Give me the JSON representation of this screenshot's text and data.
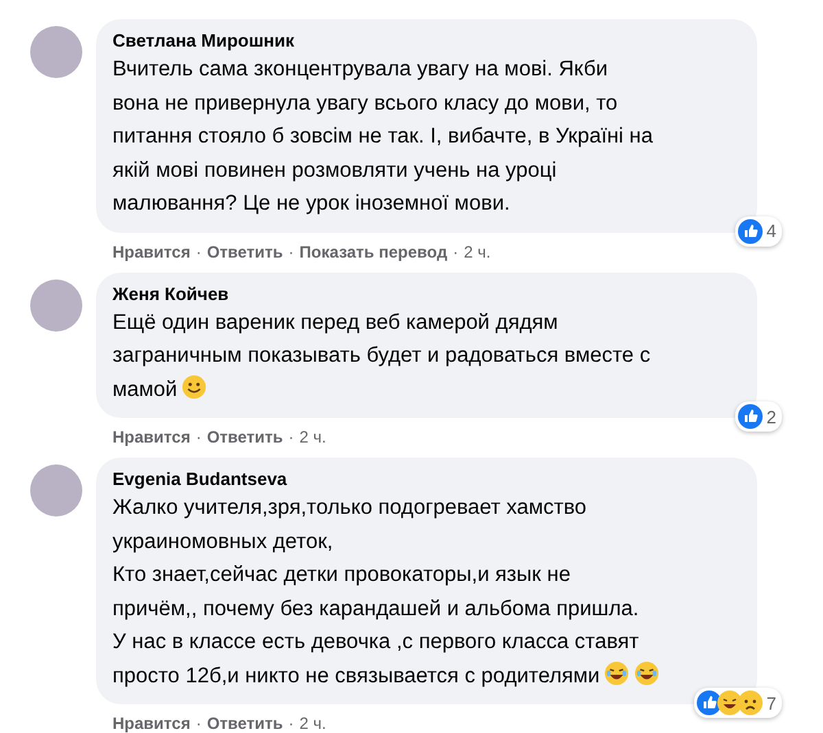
{
  "separator": "·",
  "comments": [
    {
      "author": "Светлана Мирошник",
      "text": "Вчитель сама зконцентрувала увагу на мові. Якби\nвона не привернула увагу всього класу до мови, то\nпитання стояло б зовсім не так. І, вибачте, в Україні на\nякій мові повинен розмовляти учень на уроці\nмалювання? Це не урок іноземної мови.",
      "reactions": [
        {
          "kind": "like"
        }
      ],
      "reaction_count": "4",
      "actions": [
        "Нравится",
        "Ответить",
        "Показать перевод"
      ],
      "time": "2 ч."
    },
    {
      "author": "Женя Койчев",
      "text": "Ещё один вареник перед веб камерой дядям\nзаграничным показывать будет и радоваться вместе с\nмамой",
      "emoji": [
        {
          "kind": "smile"
        }
      ],
      "reactions": [
        {
          "kind": "like"
        }
      ],
      "reaction_count": "2",
      "actions": [
        "Нравится",
        "Ответить"
      ],
      "time": "2 ч."
    },
    {
      "author": "Evgenia Budantseva",
      "text": "Жалко учителя,зря,только подогревает хамство\nукраиномовных деток,\nКто знает,сейчас детки провокаторы,и язык не\nпричём,, почему без карандашей и альбома пришла.\nУ нас в классе есть девочка ,с первого класса ставят\nпросто 12б,и никто не связывается с родителями",
      "emoji": [
        {
          "kind": "laugh"
        },
        {
          "kind": "laugh"
        }
      ],
      "reactions": [
        {
          "kind": "like"
        },
        {
          "kind": "haha"
        },
        {
          "kind": "sad"
        }
      ],
      "reaction_count": "7",
      "actions": [
        "Нравится",
        "Ответить"
      ],
      "time": "2 ч."
    }
  ]
}
